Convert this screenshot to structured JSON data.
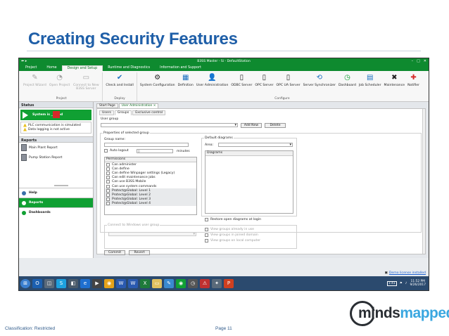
{
  "slide": {
    "title": "Creating Security Features",
    "classification": "Classification: Restricted",
    "page": "Page 11",
    "logo": {
      "part1": "minds",
      "part2": "mapped"
    }
  },
  "window": {
    "title": "B3SS Master - Si - DefaultStation",
    "controls": [
      "–",
      "□",
      "✕"
    ]
  },
  "ribbon_tabs": [
    "Project",
    "Home",
    "Design and Setup",
    "Runtime and Diagnostics",
    "Information and Support"
  ],
  "ribbon_active_tab": "Design and Setup",
  "ribbon_groups": [
    {
      "label": "Project",
      "buttons": [
        {
          "label": "Project Wizard",
          "icon": "wizard-icon",
          "disabled": true
        },
        {
          "label": "Open Project",
          "icon": "open-project-icon",
          "disabled": true
        },
        {
          "label": "Connect to New B3SS Server",
          "icon": "connect-server-icon",
          "disabled": true
        }
      ]
    },
    {
      "label": "Deploy",
      "buttons": [
        {
          "label": "Check and Install",
          "icon": "check-install-icon",
          "disabled": false
        }
      ]
    },
    {
      "label": "Configure",
      "buttons": [
        {
          "label": "System Configuration",
          "icon": "system-config-icon",
          "disabled": false
        },
        {
          "label": "Definition",
          "icon": "definition-icon",
          "disabled": false
        },
        {
          "label": "User Administration",
          "icon": "user-admin-icon",
          "disabled": false
        },
        {
          "label": "ODBC Server",
          "icon": "odbc-icon",
          "disabled": false
        },
        {
          "label": "OPC Server",
          "icon": "opc-icon",
          "disabled": false
        },
        {
          "label": "OPC UA Server",
          "icon": "opc-ua-icon",
          "disabled": false
        },
        {
          "label": "Server Synchronizer",
          "icon": "sync-icon",
          "disabled": false
        },
        {
          "label": "Dashboard",
          "icon": "dashboard-icon",
          "disabled": false
        },
        {
          "label": "Job Scheduler",
          "icon": "scheduler-icon",
          "disabled": false
        },
        {
          "label": "Maintenance",
          "icon": "maintenance-icon",
          "disabled": false
        },
        {
          "label": "Notifier",
          "icon": "notifier-icon",
          "disabled": false
        }
      ]
    }
  ],
  "left_panel": {
    "status_header": "Status",
    "system_label": "System is ___ned",
    "alerts": [
      "PLC communication is simulated",
      "Data logging is not active"
    ],
    "reports_header": "Reports",
    "reports": [
      "Main Plant Report",
      "Pump Station Report"
    ],
    "nav": [
      "Help",
      "Reports",
      "Dashboards"
    ]
  },
  "doc_tabs": [
    "Start Page",
    "User Administration"
  ],
  "sub_tabs": [
    "Users",
    "Groups",
    "Exclusive control"
  ],
  "groups": {
    "user_group_label": "User group",
    "add_new": "Add New",
    "delete": "Delete",
    "properties_legend": "Properties of selected group",
    "group_name_label": "Group name:",
    "auto_logout": "Auto logout",
    "auto_logout_value": "0",
    "minutes": "minutes",
    "permissions_header": "Permissions",
    "permissions": [
      "Can administer",
      "Can define",
      "Can define Winpager settings (Legacy)",
      "Can edit maintenance jobs",
      "Can use B3SS Mobile",
      "Can use system commands",
      "Protect@Global: Level 1",
      "Protect@Global: Level 2",
      "Protect@Global: Level 3",
      "Protect@Global: Level 4"
    ],
    "default_diagrams_legend": "Default diagrams",
    "area_label": "Area:",
    "diagrams_header": "Diagrams",
    "restore_label": "Restore open diagrams at login",
    "windows_group_legend": "Connect to Windows user group",
    "view_options": [
      "View groups already in use",
      "View groups in joined domain",
      "View groups on local computer"
    ],
    "commit": "Commit",
    "revert": "Revert"
  },
  "license_text": "Demo license installed",
  "taskbar": {
    "time": "11:52 PM",
    "date": "9/26/2017",
    "tray_badge": "1:41"
  },
  "colors": {
    "title": "#1f5fa8",
    "app_green": "#0e8a2f",
    "status_green": "#10a033",
    "alert_red": "#d62a2a"
  }
}
